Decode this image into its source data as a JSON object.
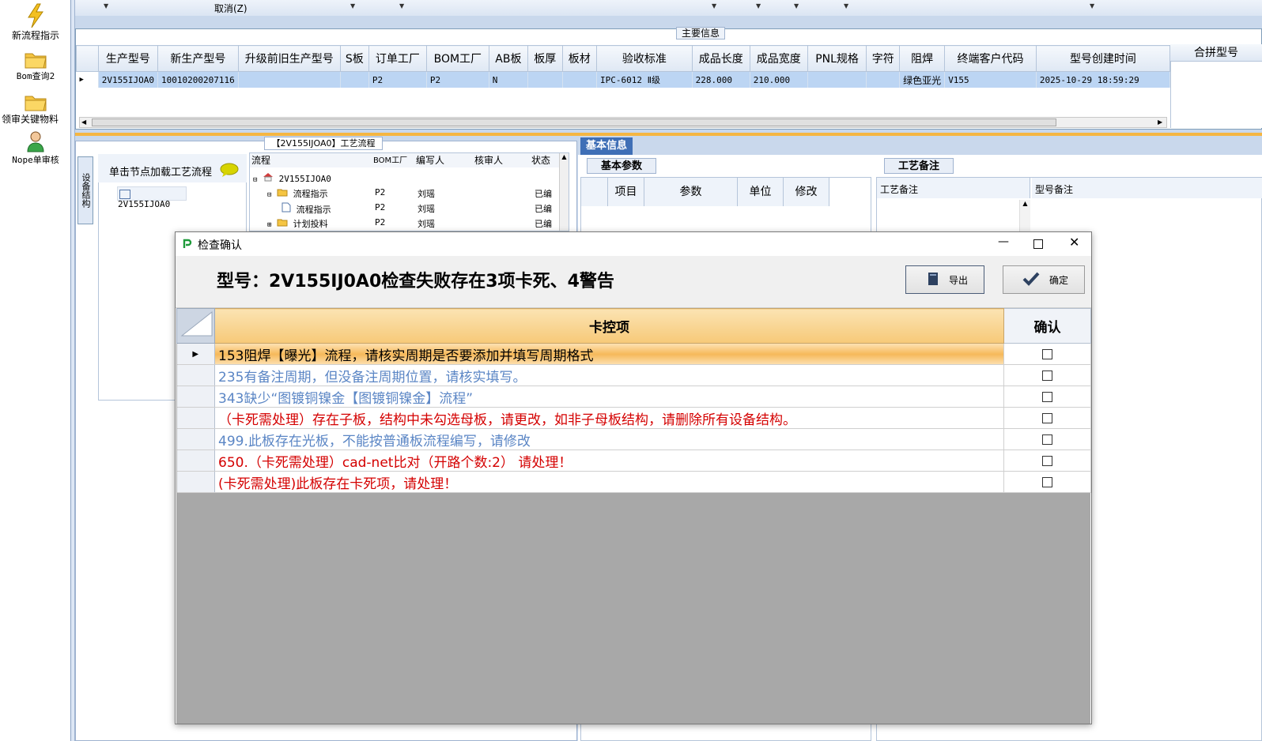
{
  "launcher": {
    "items": [
      {
        "label": "新流程指示",
        "icon": "lightning-icon"
      },
      {
        "label": "Bom查询2",
        "icon": "folder-icon"
      },
      {
        "label": "领审关键物料",
        "icon": "folder-icon"
      },
      {
        "label": "Nope单审核",
        "icon": "user-icon"
      }
    ]
  },
  "top_menu": {
    "cancel_label": "取消(Z)"
  },
  "main_info": {
    "section_label": "主要信息",
    "columns": [
      "生产型号",
      "新生产型号",
      "升级前旧生产型号",
      "S板",
      "订单工厂",
      "BOM工厂",
      "AB板",
      "板厚",
      "板材",
      "验收标准",
      "成品长度",
      "成品宽度",
      "PNL规格",
      "字符",
      "阻焊",
      "终端客户代码",
      "型号创建时间"
    ],
    "row": [
      "2V155IJOA0",
      "10010200207116",
      "",
      "",
      "P2",
      "P2",
      "N",
      "",
      "",
      "IPC-6012 Ⅱ级",
      "228.000",
      "210.000",
      "",
      "",
      "绿色亚光",
      "V155",
      "2025-10-29 18:59:29"
    ],
    "combine_label": "合拼型号"
  },
  "process": {
    "tab_label": "【2V155IJOA0】工艺流程",
    "vertical_tab": "设备结构",
    "load_hint": "单击节点加载工艺流程",
    "load_node": "2V155IJOA0",
    "tree_columns": [
      "流程",
      "BOM工厂",
      "编写人",
      "核审人",
      "状态"
    ],
    "tree_rows": [
      {
        "name": "2V155IJOA0",
        "factory": "",
        "writer": "",
        "reviewer": "",
        "status": ""
      },
      {
        "name": "流程指示",
        "factory": "P2",
        "writer": "刘瑶",
        "reviewer": "",
        "status": "已编"
      },
      {
        "name": "流程指示",
        "factory": "P2",
        "writer": "刘瑶",
        "reviewer": "",
        "status": "已编"
      },
      {
        "name": "计划投料",
        "factory": "P2",
        "writer": "刘瑶",
        "reviewer": "",
        "status": "已编"
      }
    ]
  },
  "basic_info": {
    "tab_label": "基本信息",
    "param_tab": "基本参数",
    "param_columns": [
      "项目",
      "参数",
      "单位",
      "修改"
    ],
    "note_tab": "工艺备注",
    "note_columns": [
      "工艺备注",
      "型号备注"
    ]
  },
  "dialog": {
    "title": "检查确认",
    "headline": "型号：2V155IJ0A0检查失败存在3项卡死、4警告",
    "export_label": "导出",
    "ok_label": "确定",
    "col_item": "卡控项",
    "col_confirm": "确认",
    "rows": [
      {
        "text": "153阻焊【曝光】流程，请核实周期是否要添加并填写周期格式",
        "color": "#000000",
        "selected": true
      },
      {
        "text": "235有备注周期，但没备注周期位置，请核实填写。",
        "color": "#5b86c5",
        "selected": false
      },
      {
        "text": "343缺少“图镀铜镍金【图镀铜镍金】流程”",
        "color": "#5b86c5",
        "selected": false
      },
      {
        "text": "（卡死需处理）存在子板，结构中未勾选母板，请更改，如非子母板结构，请删除所有设备结构。",
        "color": "#d40000",
        "selected": false
      },
      {
        "text": "499.此板存在光板，不能按普通板流程编写，请修改",
        "color": "#5b86c5",
        "selected": false
      },
      {
        "text": "650.（卡死需处理）cad-net比对（开路个数:2） 请处理！",
        "color": "#d40000",
        "selected": false
      },
      {
        "text": "(卡死需处理)此板存在卡死项，请处理！",
        "color": "#d40000",
        "selected": false
      }
    ]
  },
  "colors": {
    "accent": "#3f6fb6",
    "warn": "#d40000",
    "info": "#5b86c5",
    "header": "#f7c978"
  }
}
